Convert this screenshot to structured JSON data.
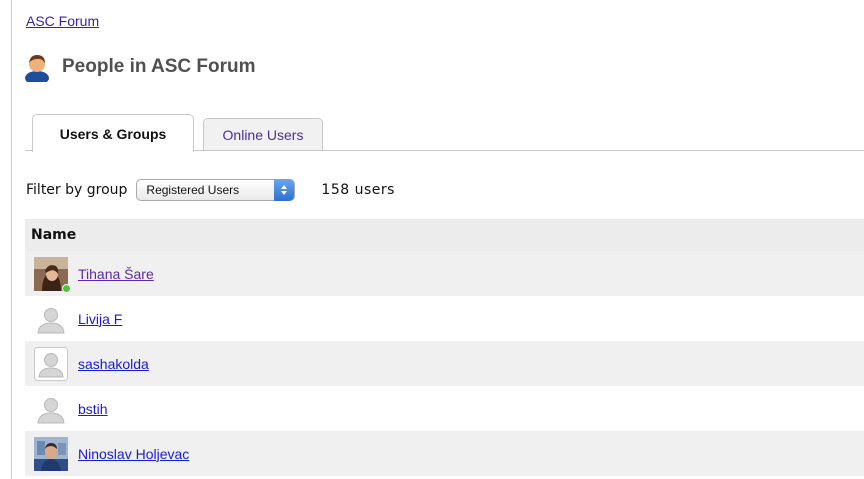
{
  "breadcrumb": {
    "label": "ASC Forum"
  },
  "header": {
    "title": "People in ASC Forum",
    "icon": "person-icon"
  },
  "tabs": [
    {
      "label": "Users & Groups",
      "active": true
    },
    {
      "label": "Online Users",
      "active": false
    }
  ],
  "filter": {
    "label": "Filter by group",
    "selected": "Registered Users",
    "count_text": "158 users"
  },
  "table": {
    "column_header": "Name",
    "rows": [
      {
        "name": "Tihana Šare",
        "avatar": "photo-avatar",
        "online": true,
        "visited": true
      },
      {
        "name": "Livija F",
        "avatar": "default-avatar",
        "online": false,
        "visited": false
      },
      {
        "name": "sashakolda",
        "avatar": "default-avatar-framed",
        "online": false,
        "visited": false
      },
      {
        "name": "bstih",
        "avatar": "default-avatar",
        "online": false,
        "visited": false
      },
      {
        "name": "Ninoslav Holjevac",
        "avatar": "photo-avatar",
        "online": false,
        "visited": false
      }
    ]
  },
  "colors": {
    "link": "#1a1ad6",
    "visited_link": "#5a2aa8",
    "online_indicator": "#4fc13a",
    "select_accent": "#2d6fd0"
  }
}
